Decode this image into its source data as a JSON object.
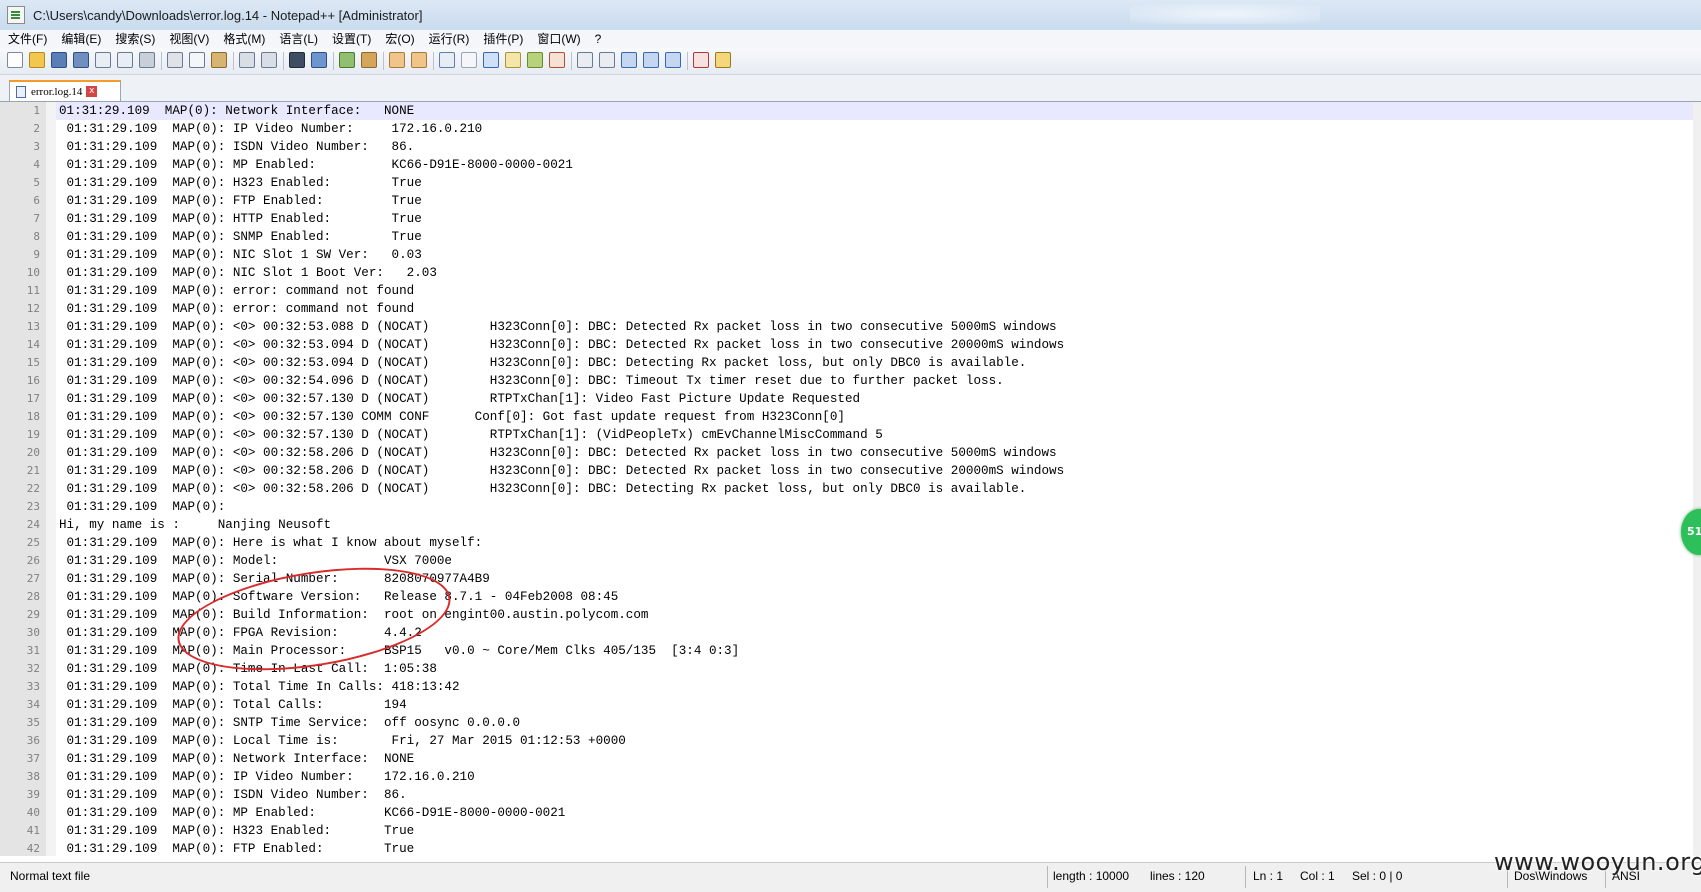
{
  "window": {
    "title": "C:\\Users\\candy\\Downloads\\error.log.14 - Notepad++ [Administrator]"
  },
  "menu": [
    "文件(F)",
    "编辑(E)",
    "搜索(S)",
    "视图(V)",
    "格式(M)",
    "语言(L)",
    "设置(T)",
    "宏(O)",
    "运行(R)",
    "插件(P)",
    "窗口(W)",
    "?"
  ],
  "tab": {
    "label": "error.log.14",
    "close": "x"
  },
  "lines": [
    {
      "n": "1",
      "t": "01:31:29.109  MAP(0): Network Interface:   NONE"
    },
    {
      "n": "2",
      "t": " 01:31:29.109  MAP(0): IP Video Number:     172.16.0.210"
    },
    {
      "n": "3",
      "t": " 01:31:29.109  MAP(0): ISDN Video Number:   86."
    },
    {
      "n": "4",
      "t": " 01:31:29.109  MAP(0): MP Enabled:          KC66-D91E-8000-0000-0021"
    },
    {
      "n": "5",
      "t": " 01:31:29.109  MAP(0): H323 Enabled:        True"
    },
    {
      "n": "6",
      "t": " 01:31:29.109  MAP(0): FTP Enabled:         True"
    },
    {
      "n": "7",
      "t": " 01:31:29.109  MAP(0): HTTP Enabled:        True"
    },
    {
      "n": "8",
      "t": " 01:31:29.109  MAP(0): SNMP Enabled:        True"
    },
    {
      "n": "9",
      "t": " 01:31:29.109  MAP(0): NIC Slot 1 SW Ver:   0.03"
    },
    {
      "n": "10",
      "t": " 01:31:29.109  MAP(0): NIC Slot 1 Boot Ver:   2.03"
    },
    {
      "n": "11",
      "t": " 01:31:29.109  MAP(0): error: command not found"
    },
    {
      "n": "12",
      "t": " 01:31:29.109  MAP(0): error: command not found"
    },
    {
      "n": "13",
      "t": " 01:31:29.109  MAP(0): <0> 00:32:53.088 D (NOCAT)        H323Conn[0]: DBC: Detected Rx packet loss in two consecutive 5000mS windows"
    },
    {
      "n": "14",
      "t": " 01:31:29.109  MAP(0): <0> 00:32:53.094 D (NOCAT)        H323Conn[0]: DBC: Detected Rx packet loss in two consecutive 20000mS windows"
    },
    {
      "n": "15",
      "t": " 01:31:29.109  MAP(0): <0> 00:32:53.094 D (NOCAT)        H323Conn[0]: DBC: Detecting Rx packet loss, but only DBC0 is available."
    },
    {
      "n": "16",
      "t": " 01:31:29.109  MAP(0): <0> 00:32:54.096 D (NOCAT)        H323Conn[0]: DBC: Timeout Tx timer reset due to further packet loss."
    },
    {
      "n": "17",
      "t": " 01:31:29.109  MAP(0): <0> 00:32:57.130 D (NOCAT)        RTPTxChan[1]: Video Fast Picture Update Requested"
    },
    {
      "n": "18",
      "t": " 01:31:29.109  MAP(0): <0> 00:32:57.130 COMM CONF      Conf[0]: Got fast update request from H323Conn[0]"
    },
    {
      "n": "19",
      "t": " 01:31:29.109  MAP(0): <0> 00:32:57.130 D (NOCAT)        RTPTxChan[1]: (VidPeopleTx) cmEvChannelMiscCommand 5"
    },
    {
      "n": "20",
      "t": " 01:31:29.109  MAP(0): <0> 00:32:58.206 D (NOCAT)        H323Conn[0]: DBC: Detected Rx packet loss in two consecutive 5000mS windows"
    },
    {
      "n": "21",
      "t": " 01:31:29.109  MAP(0): <0> 00:32:58.206 D (NOCAT)        H323Conn[0]: DBC: Detected Rx packet loss in two consecutive 20000mS windows"
    },
    {
      "n": "22",
      "t": " 01:31:29.109  MAP(0): <0> 00:32:58.206 D (NOCAT)        H323Conn[0]: DBC: Detecting Rx packet loss, but only DBC0 is available."
    },
    {
      "n": "23",
      "t": " 01:31:29.109  MAP(0):"
    },
    {
      "n": "24",
      "t": "Hi, my name is :     Nanjing Neusoft"
    },
    {
      "n": "25",
      "t": " 01:31:29.109  MAP(0): Here is what I know about myself:"
    },
    {
      "n": "26",
      "t": " 01:31:29.109  MAP(0): Model:              VSX 7000e"
    },
    {
      "n": "27",
      "t": " 01:31:29.109  MAP(0): Serial Number:      8208070977A4B9"
    },
    {
      "n": "28",
      "t": " 01:31:29.109  MAP(0): Software Version:   Release 8.7.1 - 04Feb2008 08:45"
    },
    {
      "n": "29",
      "t": " 01:31:29.109  MAP(0): Build Information:  root on engint00.austin.polycom.com"
    },
    {
      "n": "30",
      "t": " 01:31:29.109  MAP(0): FPGA Revision:      4.4.2"
    },
    {
      "n": "31",
      "t": " 01:31:29.109  MAP(0): Main Processor:     BSP15   v0.0 ~ Core/Mem Clks 405/135  [3:4 0:3]"
    },
    {
      "n": "32",
      "t": " 01:31:29.109  MAP(0): Time In Last Call:  1:05:38"
    },
    {
      "n": "33",
      "t": " 01:31:29.109  MAP(0): Total Time In Calls: 418:13:42"
    },
    {
      "n": "34",
      "t": " 01:31:29.109  MAP(0): Total Calls:        194"
    },
    {
      "n": "35",
      "t": " 01:31:29.109  MAP(0): SNTP Time Service:  off oosync 0.0.0.0"
    },
    {
      "n": "36",
      "t": " 01:31:29.109  MAP(0): Local Time is:       Fri, 27 Mar 2015 01:12:53 +0000"
    },
    {
      "n": "37",
      "t": " 01:31:29.109  MAP(0): Network Interface:  NONE"
    },
    {
      "n": "38",
      "t": " 01:31:29.109  MAP(0): IP Video Number:    172.16.0.210"
    },
    {
      "n": "39",
      "t": " 01:31:29.109  MAP(0): ISDN Video Number:  86."
    },
    {
      "n": "40",
      "t": " 01:31:29.109  MAP(0): MP Enabled:         KC66-D91E-8000-0000-0021"
    },
    {
      "n": "41",
      "t": " 01:31:29.109  MAP(0): H323 Enabled:       True"
    },
    {
      "n": "42",
      "t": " 01:31:29.109  MAP(0): FTP Enabled:        True"
    }
  ],
  "side_badge": "51",
  "status": {
    "file_type": "Normal text file",
    "length": "length : 10000",
    "lines": "lines : 120",
    "ln": "Ln : 1",
    "col": "Col : 1",
    "sel": "Sel : 0 | 0",
    "eol": "Dos\\Windows",
    "encoding": "ANSI"
  },
  "watermark": "www.wooyun.org",
  "colors": {
    "annotation": "#d92b2b",
    "tab_accent": "#f59b2b",
    "badge": "#2cbf5a"
  }
}
